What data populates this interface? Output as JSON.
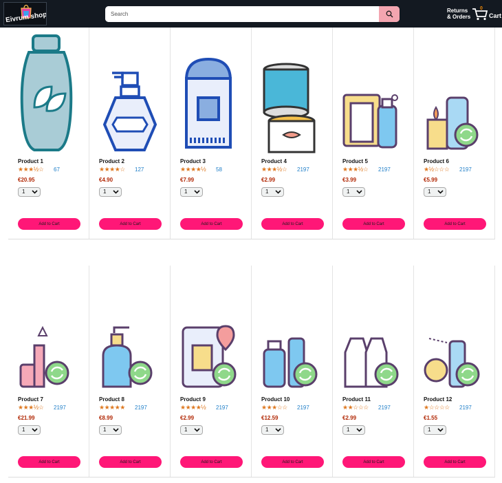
{
  "header": {
    "logo_text": "Eivrum shop",
    "search_placeholder": "Search",
    "returns_line1": "Returns",
    "returns_line2": "& Orders",
    "cart_label": "Cart",
    "cart_count": "0"
  },
  "colors": {
    "topbar": "#131921",
    "accent_pink": "#ff1777",
    "price_red": "#b12704",
    "star_orange": "#de7921",
    "link_blue": "#1e7ec8"
  },
  "products": [
    {
      "name": "Product 1",
      "rating": 3.5,
      "stars": "★★★½☆",
      "reviews": "67",
      "price": "€20.95",
      "qty": "1",
      "add_label": "Add to Cart",
      "icon": "shampoo-bottle-icon"
    },
    {
      "name": "Product 2",
      "rating": 4,
      "stars": "★★★★☆",
      "reviews": "127",
      "price": "€4.90",
      "qty": "1",
      "add_label": "Add to Cart",
      "icon": "perfume-pump-icon"
    },
    {
      "name": "Product 3",
      "rating": 4.5,
      "stars": "★★★★½",
      "reviews": "58",
      "price": "€7.99",
      "qty": "1",
      "add_label": "Add to Cart",
      "icon": "deodorant-stick-icon"
    },
    {
      "name": "Product 4",
      "rating": 3.5,
      "stars": "★★★½☆",
      "reviews": "2197",
      "price": "€2.99",
      "qty": "1",
      "add_label": "Add to Cart",
      "icon": "canned-food-icon"
    },
    {
      "name": "Product 5",
      "rating": 3.5,
      "stars": "★★★½☆",
      "reviews": "2197",
      "price": "€3.99",
      "qty": "1",
      "add_label": "Add to Cart",
      "icon": "soap-dispenser-icon"
    },
    {
      "name": "Product 6",
      "rating": 1.5,
      "stars": "★½☆☆☆",
      "reviews": "2197",
      "price": "€5.99",
      "qty": "1",
      "add_label": "Add to Cart",
      "icon": "lighter-aerosol-recycle-icon"
    },
    {
      "name": "Product 7",
      "rating": 3.5,
      "stars": "★★★½☆",
      "reviews": "2197",
      "price": "€21.99",
      "qty": "1",
      "add_label": "Add to Cart",
      "icon": "cosmetics-recycle-icon"
    },
    {
      "name": "Product 8",
      "rating": 5,
      "stars": "★★★★★",
      "reviews": "2197",
      "price": "€8.99",
      "qty": "1",
      "add_label": "Add to Cart",
      "icon": "soap-pump-recycle-icon"
    },
    {
      "name": "Product 9",
      "rating": 4.5,
      "stars": "★★★★½",
      "reviews": "2197",
      "price": "€2.99",
      "qty": "1",
      "add_label": "Add to Cart",
      "icon": "coffee-location-recycle-icon"
    },
    {
      "name": "Product 10",
      "rating": 3,
      "stars": "★★★☆☆",
      "reviews": "2197",
      "price": "€12.59",
      "qty": "1",
      "add_label": "Add to Cart",
      "icon": "water-bottles-recycle-icon"
    },
    {
      "name": "Product 11",
      "rating": 2,
      "stars": "★★☆☆☆",
      "reviews": "2197",
      "price": "€2.99",
      "qty": "1",
      "add_label": "Add to Cart",
      "icon": "milk-bottles-recycle-icon"
    },
    {
      "name": "Product 12",
      "rating": 1,
      "stars": "★☆☆☆☆",
      "reviews": "2197",
      "price": "€1.55",
      "qty": "1",
      "add_label": "Add to Cart",
      "icon": "spray-face-recycle-icon"
    }
  ]
}
